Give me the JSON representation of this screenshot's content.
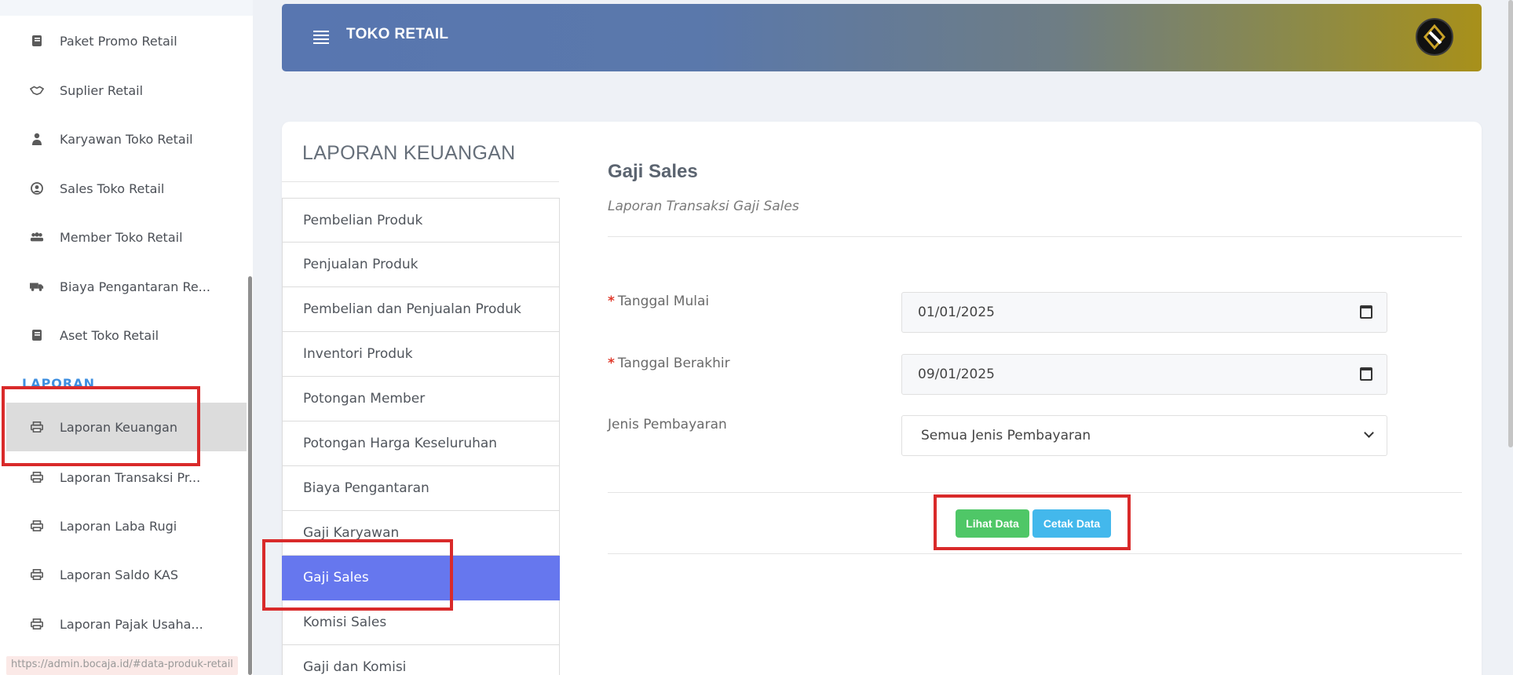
{
  "sidebar": {
    "items": [
      {
        "label": "Paket Promo Retail",
        "icon": "book-icon"
      },
      {
        "label": "Suplier Retail",
        "icon": "handshake-icon"
      },
      {
        "label": "Karyawan Toko Retail",
        "icon": "user-tie-icon"
      },
      {
        "label": "Sales Toko Retail",
        "icon": "user-circle-icon"
      },
      {
        "label": "Member Toko Retail",
        "icon": "users-icon"
      },
      {
        "label": "Biaya Pengantaran Re...",
        "icon": "truck-icon"
      },
      {
        "label": "Aset Toko Retail",
        "icon": "book-icon"
      }
    ],
    "section_label": "LAPORAN",
    "report_items": [
      {
        "label": "Laporan Keuangan",
        "icon": "print-icon",
        "active": true
      },
      {
        "label": "Laporan Transaksi Pr...",
        "icon": "print-icon"
      },
      {
        "label": "Laporan Laba Rugi",
        "icon": "print-icon"
      },
      {
        "label": "Laporan Saldo KAS",
        "icon": "print-icon"
      },
      {
        "label": "Laporan Pajak Usaha...",
        "icon": "print-icon"
      }
    ],
    "status_url": "https://admin.bocaja.id/#data-produk-retail"
  },
  "header": {
    "brand": "TOKO RETAIL",
    "colors": {
      "start": "#5876b0",
      "end": "#a8901a"
    }
  },
  "card": {
    "title": "LAPORAN KEUANGAN",
    "menu": [
      {
        "label": "Pembelian Produk"
      },
      {
        "label": "Penjualan Produk"
      },
      {
        "label": "Pembelian dan Penjualan Produk"
      },
      {
        "label": "Inventori Produk"
      },
      {
        "label": "Potongan Member"
      },
      {
        "label": "Potongan Harga Keseluruhan"
      },
      {
        "label": "Biaya Pengantaran"
      },
      {
        "label": "Gaji Karyawan"
      },
      {
        "label": "Gaji Sales",
        "active": true
      },
      {
        "label": "Komisi Sales"
      },
      {
        "label": "Gaji dan Komisi"
      }
    ],
    "active_color": "#6677ee"
  },
  "content": {
    "title": "Gaji Sales",
    "subtitle": "Laporan Transaksi Gaji Sales",
    "fields": {
      "start": {
        "label": "Tanggal Mulai",
        "required_mark": "*",
        "value": "01/01/2025"
      },
      "end": {
        "label": "Tanggal Berakhir",
        "required_mark": "*",
        "value": "09/01/2025"
      },
      "payment": {
        "label": "Jenis Pembayaran",
        "value": "Semua Jenis Pembayaran"
      }
    },
    "buttons": {
      "view": "Lihat Data",
      "print": "Cetak Data"
    }
  }
}
